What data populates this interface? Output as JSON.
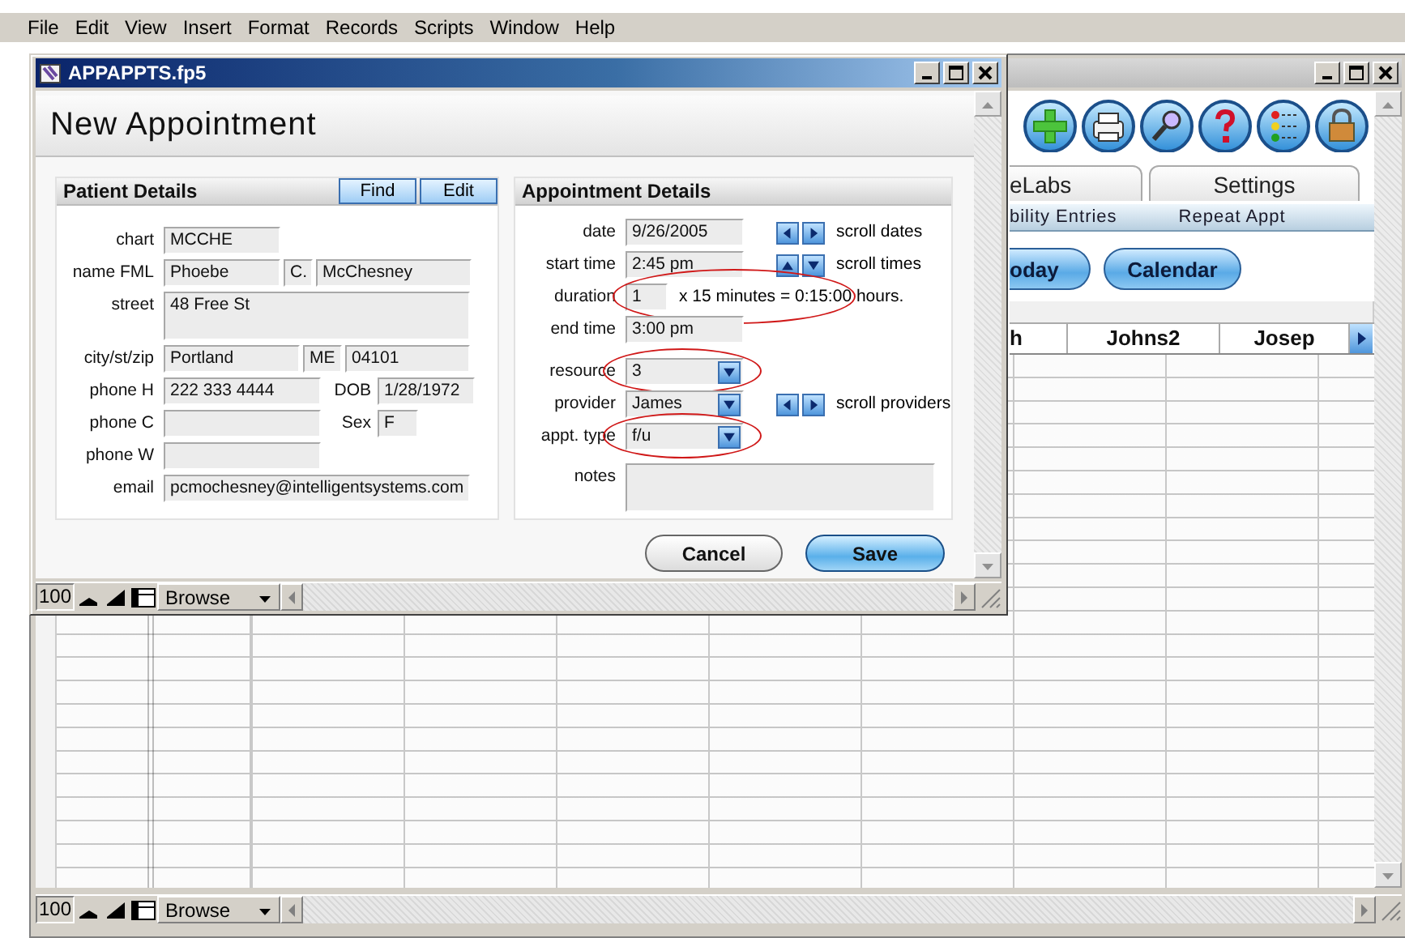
{
  "menu_bar": [
    "File",
    "Edit",
    "View",
    "Insert",
    "Format",
    "Records",
    "Scripts",
    "Window",
    "Help"
  ],
  "main_window": {
    "tabs": [
      {
        "label": "eLabs",
        "selected": false
      },
      {
        "label": "Settings",
        "selected": false
      }
    ],
    "subtabs": [
      "bility Entries",
      "Repeat Appt"
    ],
    "buttons": [
      "oday",
      "Calendar"
    ],
    "grid": {
      "columns": [
        "h",
        "Johns2",
        "Josep"
      ]
    },
    "status_bar": {
      "zoom": "100",
      "mode": "Browse"
    }
  },
  "dialog": {
    "title": "APPAPPTS.fp5",
    "heading": "New Appointment",
    "patient_details": {
      "title": "Patient Details",
      "buttons": [
        "Find",
        "Edit"
      ],
      "rows": [
        {
          "label": "chart",
          "fields": [
            {
              "value": "MCCHE"
            }
          ]
        },
        {
          "label": "name FML",
          "fields": [
            {
              "value": "Phoebe"
            },
            {
              "value": "C."
            },
            {
              "value": "McChesney"
            }
          ]
        },
        {
          "label": "street",
          "fields": [
            {
              "value": "48 Free St"
            }
          ]
        },
        {
          "label": "city/st/zip",
          "fields": [
            {
              "value": "Portland"
            },
            {
              "value": "ME"
            },
            {
              "value": "04101"
            }
          ]
        },
        {
          "label": "phone H",
          "fields": [
            {
              "value": "222 333 4444"
            }
          ],
          "extra": {
            "label": "DOB",
            "value": "1/28/1972"
          }
        },
        {
          "label": "phone C",
          "extra": {
            "label": "Sex",
            "value": "F"
          }
        },
        {
          "label": "phone W"
        },
        {
          "label": "email",
          "fields": [
            {
              "value": "pcmochesney@intelligentsystems.com"
            }
          ]
        }
      ]
    },
    "appointment_details": {
      "title": "Appointment Details",
      "rows": [
        {
          "kind": "text",
          "label": "date",
          "value": "9/26/2005",
          "circled": false,
          "scroll": {
            "kind": "horizontal",
            "label": "scroll dates"
          }
        },
        {
          "kind": "text",
          "label": "start time",
          "value": "2:45 pm",
          "circled": false,
          "scroll": {
            "kind": "vertical",
            "label": "scroll times"
          }
        },
        {
          "kind": "short",
          "label": "duration",
          "value": "1",
          "suffix": "x 15 minutes = 0:15:00 hours.",
          "circled": true
        },
        {
          "kind": "text",
          "label": "end time",
          "value": "3:00 pm",
          "circled": false
        },
        {
          "kind": "dropdown",
          "label": "resource",
          "value": "3",
          "circled": true
        },
        {
          "kind": "dropdown",
          "label": "provider",
          "value": "James",
          "circled": false,
          "scroll": {
            "kind": "horizontal",
            "label": "scroll providers"
          }
        },
        {
          "kind": "dropdown",
          "label": "appt. type",
          "value": "f/u",
          "circled": true
        },
        {
          "kind": "notes",
          "label": "notes",
          "circled": false
        }
      ]
    },
    "buttons": [
      {
        "label": "Cancel",
        "kind": "default"
      },
      {
        "label": "Save",
        "kind": "primary"
      }
    ],
    "status_bar": {
      "zoom": "100",
      "mode": "Browse"
    }
  }
}
